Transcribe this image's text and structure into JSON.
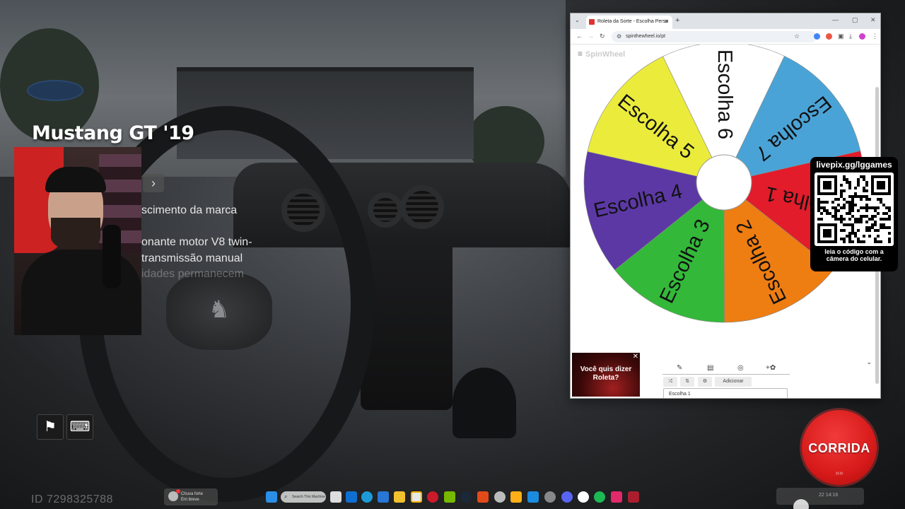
{
  "game": {
    "car_title": "Mustang GT  '19",
    "description_lines": [
      "scimento da marca",
      "onante motor V8 twin-",
      "transmissão manual",
      "idades permanecem"
    ],
    "arrow_icon": "chevron-right-icon",
    "player_id": "ID 7298325788",
    "race_button_label": "CORRIDA",
    "race_button_sub": "»»",
    "hud_buttons": [
      "flag-icon",
      "chat-icon"
    ]
  },
  "browser": {
    "tab_title": "Roleta da Sorte - Escolha Perso",
    "url": "spinthewheel.io/pt",
    "page_brand": "SpinWheel",
    "accent_color": "#d93025"
  },
  "wheel": {
    "segments": [
      {
        "label": "Escolha 1",
        "color": "#e21c2a"
      },
      {
        "label": "Escolha 2",
        "color": "#ee7d12"
      },
      {
        "label": "Escolha 3",
        "color": "#34b83a"
      },
      {
        "label": "Escolha 4",
        "color": "#5c38a5"
      },
      {
        "label": "Escolha 5",
        "color": "#ebeb3c"
      },
      {
        "label": "Escolha 6",
        "color": "#ffffff"
      },
      {
        "label": "Escolha 7",
        "color": "#4aa3d6"
      }
    ]
  },
  "editor": {
    "tabs": [
      "pencil-icon",
      "clipboard-icon",
      "eye-off-icon",
      "color-wheel-icon"
    ],
    "shuffle_icon": "shuffle-icon",
    "sort_icon": "sort-icon",
    "settings_icon": "gear-icon",
    "add_button": "Adicionar",
    "first_entry": "Escolha 1"
  },
  "ad": {
    "text": "Você quis dizer Roleta?"
  },
  "qr_overlay": {
    "title": "livepix.gg/lggames",
    "caption": "leia o código com a câmera do celular."
  },
  "taskbar": {
    "weather_text": "Chuva forte",
    "weather_sub": "Em breve",
    "search_placeholder": "Search This Machine",
    "tray_text": "22  14:16"
  }
}
